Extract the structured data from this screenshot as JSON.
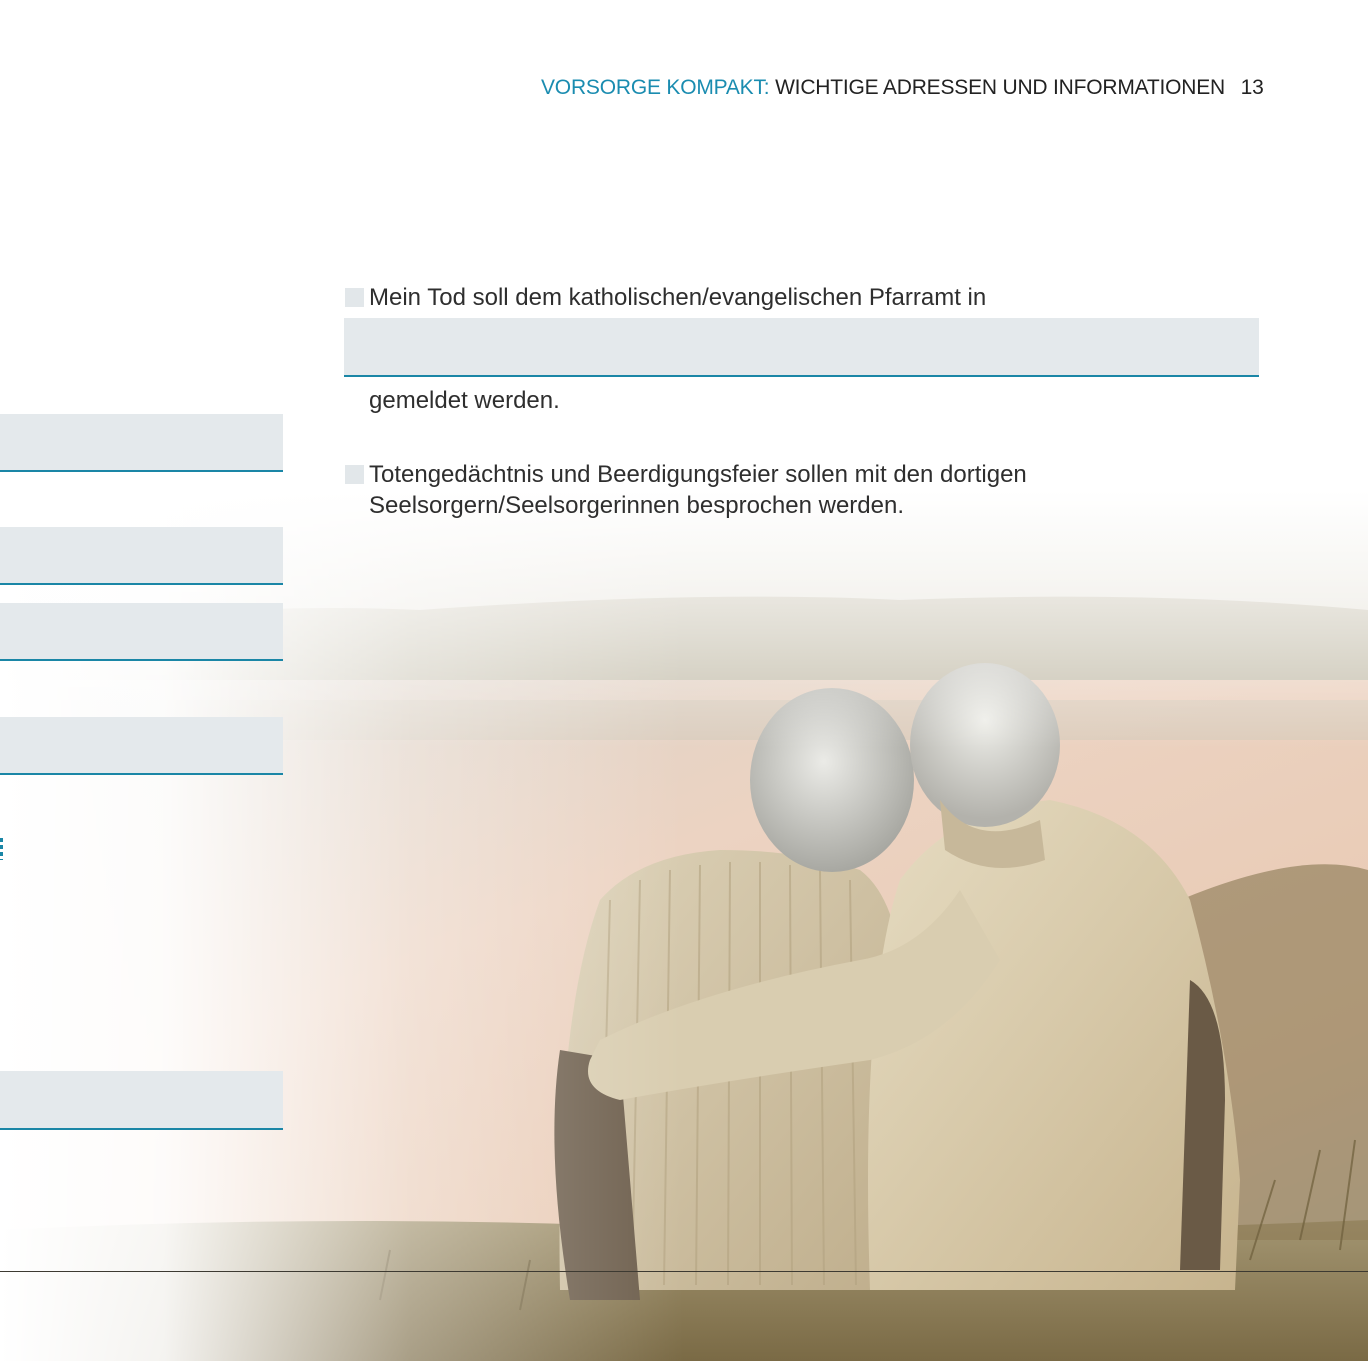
{
  "header": {
    "section": "VORSORGE KOMPAKT:",
    "title": "WICHTIGE ADRESSEN UND INFORMATIONEN",
    "page_number": "13"
  },
  "items": [
    {
      "text": "Mein Tod soll dem katholischen/evangelischen Pfarramt in",
      "after_field": "gemeldet werden."
    },
    {
      "line1": "Totengedächtnis und Beerdigungsfeier sollen mit den dortigen",
      "line2": "Seelsorgern/Seelsorgerinnen besprochen werden."
    }
  ],
  "colors": {
    "accent": "#1a8cb0",
    "field_bg": "#e4e9ec",
    "field_line": "#1a86a6"
  },
  "photo": {
    "subject": "elderly-couple-by-lake-icon"
  }
}
